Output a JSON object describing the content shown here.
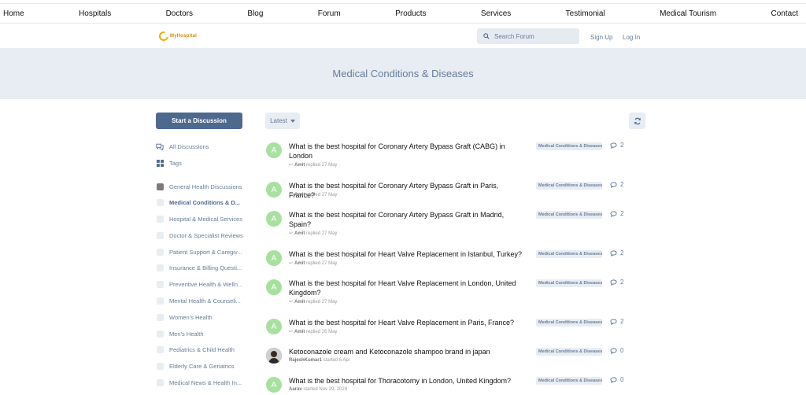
{
  "topnav": [
    "Home",
    "Hospitals",
    "Doctors",
    "Blog",
    "Forum",
    "Products",
    "Services",
    "Testimonial",
    "Medical Tourism",
    "Contact"
  ],
  "header": {
    "logo_text": "MyHospital",
    "search_placeholder": "Search Forum",
    "signup": "Sign Up",
    "login": "Log In"
  },
  "hero": {
    "title": "Medical Conditions & Diseases"
  },
  "sidebar": {
    "start_button": "Start a Discussion",
    "nav": [
      {
        "label": "All Discussions",
        "icon": "comments-icon"
      },
      {
        "label": "Tags",
        "icon": "grid-icon"
      }
    ],
    "tags": [
      {
        "label": "General Health Discussions",
        "color": "#7b7b7b"
      },
      {
        "label": "Medical Conditions & D...",
        "active": true
      },
      {
        "label": "Hospital & Medical Services"
      },
      {
        "label": "Doctor & Specialist Reviews"
      },
      {
        "label": "Patient Support & Caregiv..."
      },
      {
        "label": "Insurance & Billing Questi..."
      },
      {
        "label": "Preventive Health & Welln..."
      },
      {
        "label": "Mental Health & Counseli..."
      },
      {
        "label": "Women's Health"
      },
      {
        "label": "Men's Health"
      },
      {
        "label": "Pediatrics & Child Health"
      },
      {
        "label": "Elderly Care & Geriatrics"
      },
      {
        "label": "Medical News & Health In..."
      }
    ]
  },
  "toolbar": {
    "sort_label": "Latest"
  },
  "discussions": [
    {
      "initial": "A",
      "title": "What is the best hospital for Coronary Artery Bypass Graft (CABG) in London",
      "user": "Amit",
      "action": "replied 27 May",
      "tag": "Medical Conditions & Diseases",
      "replies": "2"
    },
    {
      "initial": "A",
      "title": "What is the best hospital for Coronary Artery Bypass Graft in Paris, France?",
      "user": "Amit",
      "action": "replied 27 May",
      "tag": "Medical Conditions & Diseases",
      "replies": "2"
    },
    {
      "initial": "A",
      "title": "What is the best hospital for Coronary Artery Bypass Graft in Madrid, Spain?",
      "user": "Amit",
      "action": "replied 27 May",
      "tag": "Medical Conditions & Diseases",
      "replies": "2"
    },
    {
      "initial": "A",
      "title": "What is the best hospital for Heart Valve Replacement in Istanbul, Turkey?",
      "user": "Amit",
      "action": "replied 27 May",
      "tag": "Medical Conditions & Diseases",
      "replies": "2"
    },
    {
      "initial": "A",
      "title": "What is the best hospital for Heart Valve Replacement in London, United Kingdom?",
      "user": "Amit",
      "action": "replied 27 May",
      "tag": "Medical Conditions & Diseases",
      "replies": "2"
    },
    {
      "initial": "A",
      "title": "What is the best hospital for Heart Valve Replacement in Paris, France?",
      "user": "Amit",
      "action": "replied 26 May",
      "tag": "Medical Conditions & Diseases",
      "replies": "2"
    },
    {
      "initial": "",
      "title": "Ketoconazole cream and Ketoconazole shampoo brand in japan",
      "user": "RajeshKumar1",
      "action": "started 6 Apr",
      "tag": "Medical Conditions & Diseases",
      "replies": "0",
      "photo": true
    },
    {
      "initial": "A",
      "title": "What is the best hospital for Thoracotomy in London, United Kingdom?",
      "user": "Aarav",
      "action": "started Nov 29, 2024",
      "tag": "Medical Conditions & Diseases",
      "replies": "0"
    }
  ]
}
